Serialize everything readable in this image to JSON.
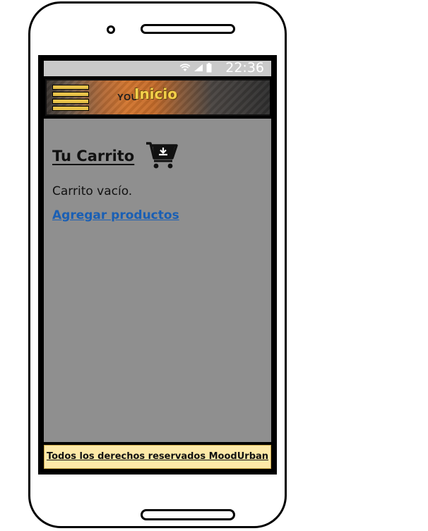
{
  "statusbar": {
    "time": "22:36",
    "wifi_icon": "wifi-icon",
    "signal_icon": "signal-icon",
    "battery_icon": "battery-icon"
  },
  "appbar": {
    "title": "Inicio",
    "banner_print": "YOU",
    "menu_icon": "hamburger-menu-icon",
    "title_color": "#f4d04a",
    "menu_color": "#e8c24a"
  },
  "cart": {
    "heading": "Tu Carrito",
    "icon": "cart-download-icon",
    "empty_message": "Carrito vacío.",
    "add_link": "Agregar productos"
  },
  "footer": {
    "text": "Todos los derechos reservados MoodUrban",
    "background": "#fde9a8"
  },
  "colors": {
    "content_bg": "#8f8f8f",
    "link": "#1a5fb4",
    "statusbar_bg": "#c9c9c9"
  }
}
